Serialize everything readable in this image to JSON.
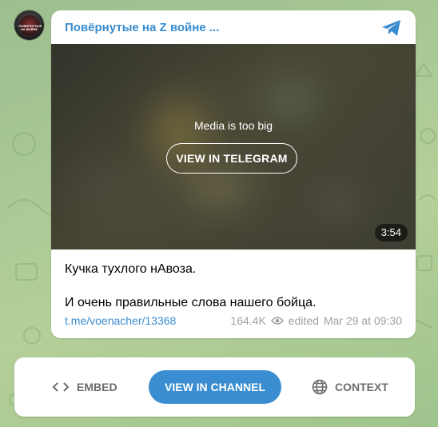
{
  "post": {
    "channel_title": "Повёрнутые на Z войне ...",
    "avatar_caption": "ПОВЕРНУТЫЕ НА ВОЙНЕ",
    "media": {
      "message": "Media is too big",
      "view_button": "VIEW IN TELEGRAM",
      "duration": "3:54"
    },
    "text_line1": "Кучка тухлого нАвоза.",
    "text_line2": "И очень правильные слова нашего бойца.",
    "link": "t.me/voenacher/13368",
    "views": "164.4K",
    "edited": "edited",
    "date": "Mar 29 at 09:30"
  },
  "actions": {
    "embed": "EMBED",
    "view_channel": "VIEW IN CHANNEL",
    "context": "CONTEXT"
  },
  "colors": {
    "accent": "#3a8dd0",
    "background": "#a9c995"
  }
}
